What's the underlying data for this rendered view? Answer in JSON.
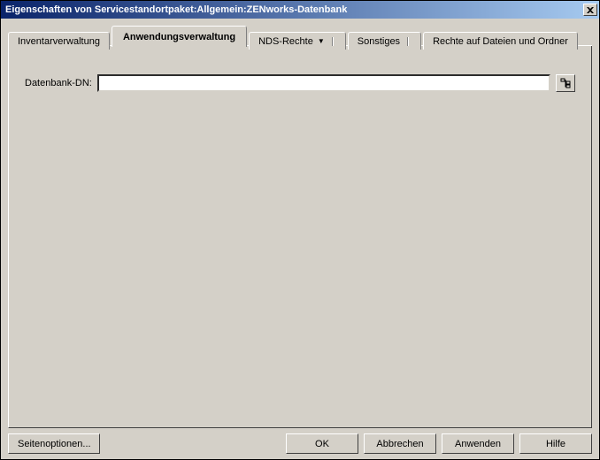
{
  "window": {
    "title": "Eigenschaften von Servicestandortpaket:Allgemein:ZENworks-Datenbank",
    "close_icon": "close"
  },
  "tabs": {
    "items": [
      {
        "label": "Inventarverwaltung",
        "has_dropdown": false
      },
      {
        "label": "Anwendungsverwaltung",
        "has_dropdown": false
      },
      {
        "label": "NDS-Rechte",
        "has_dropdown": true
      },
      {
        "label": "Sonstiges",
        "has_dropdown": false
      },
      {
        "label": "Rechte auf Dateien und Ordner",
        "has_dropdown": false
      }
    ],
    "active_index": 1
  },
  "main": {
    "field_label": "Datenbank-DN:",
    "field_value": "",
    "browse_icon": "tree-browse"
  },
  "footer": {
    "page_options_label": "Seitenoptionen...",
    "ok_label": "OK",
    "cancel_label": "Abbrechen",
    "apply_label": "Anwenden",
    "help_label": "Hilfe"
  }
}
